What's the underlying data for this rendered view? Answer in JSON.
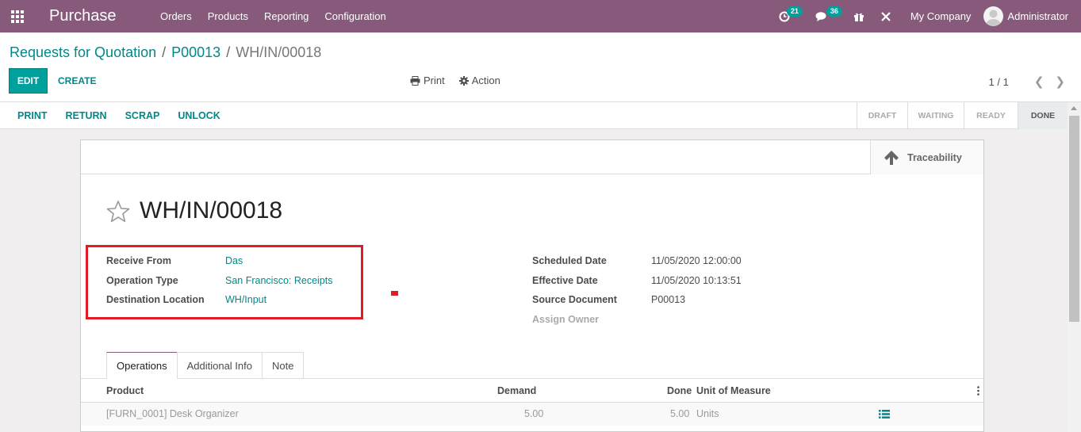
{
  "navbar": {
    "app_name": "Purchase",
    "menu": [
      "Orders",
      "Products",
      "Reporting",
      "Configuration"
    ],
    "activity_count": "21",
    "messages_count": "36",
    "company": "My Company",
    "user": "Administrator"
  },
  "breadcrumb": {
    "items": [
      "Requests for Quotation",
      "P00013"
    ],
    "current": "WH/IN/00018"
  },
  "toolbar": {
    "edit_label": "EDIT",
    "create_label": "CREATE",
    "print_label": "Print",
    "action_label": "Action",
    "pager": "1 / 1"
  },
  "statusbar": {
    "buttons": [
      "PRINT",
      "RETURN",
      "SCRAP",
      "UNLOCK"
    ],
    "stages": [
      "DRAFT",
      "WAITING",
      "READY",
      "DONE"
    ],
    "current_stage": "DONE"
  },
  "form": {
    "traceability_label": "Traceability",
    "title": "WH/IN/00018",
    "left_fields": [
      {
        "label": "Receive From",
        "value": "Das"
      },
      {
        "label": "Operation Type",
        "value": "San Francisco: Receipts"
      },
      {
        "label": "Destination Location",
        "value": "WH/Input"
      }
    ],
    "right_fields": [
      {
        "label": "Scheduled Date",
        "value": "11/05/2020 12:00:00"
      },
      {
        "label": "Effective Date",
        "value": "11/05/2020 10:13:51"
      },
      {
        "label": "Source Document",
        "value": "P00013"
      },
      {
        "label": "Assign Owner",
        "value": ""
      }
    ],
    "tabs": [
      "Operations",
      "Additional Info",
      "Note"
    ],
    "table": {
      "headers": [
        "Product",
        "Demand",
        "Done",
        "Unit of Measure"
      ],
      "rows": [
        {
          "product": "[FURN_0001] Desk Organizer",
          "demand": "5.00",
          "done": "5.00",
          "uom": "Units"
        }
      ]
    }
  },
  "colors": {
    "navbar": "#875a7b",
    "primary": "#00a09d",
    "link": "#00888a",
    "highlight": "#e01b24"
  }
}
